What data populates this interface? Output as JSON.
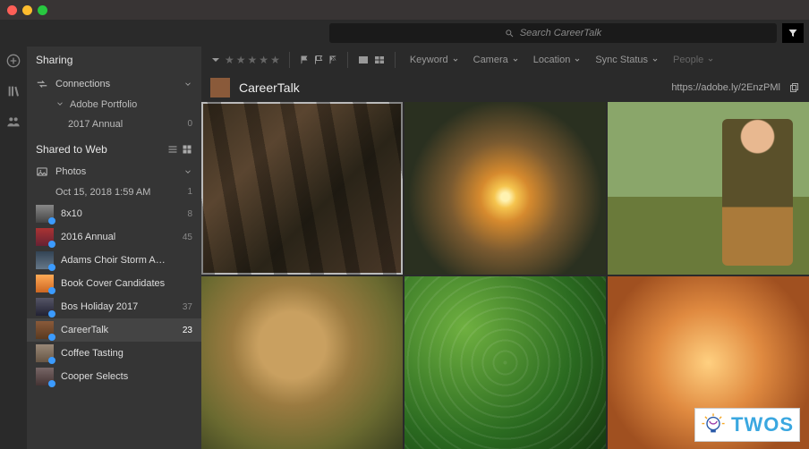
{
  "search": {
    "placeholder": "Search CareerTalk"
  },
  "sidebar": {
    "sharing_label": "Sharing",
    "connections_label": "Connections",
    "portfolio_label": "Adobe Portfolio",
    "annual_label": "2017 Annual",
    "annual_count": "0",
    "shared_to_web_label": "Shared to Web",
    "photos_label": "Photos",
    "photos_date": "Oct 15, 2018 1:59 AM",
    "photos_count": "1"
  },
  "albums": [
    {
      "name": "8x10",
      "count": "8"
    },
    {
      "name": "2016 Annual",
      "count": "45"
    },
    {
      "name": "Adams Choir Storm A…",
      "count": ""
    },
    {
      "name": "Book Cover Candidates",
      "count": ""
    },
    {
      "name": "Bos Holiday 2017",
      "count": "37"
    },
    {
      "name": "CareerTalk",
      "count": "23"
    },
    {
      "name": "Coffee Tasting",
      "count": ""
    },
    {
      "name": "Cooper Selects",
      "count": ""
    }
  ],
  "toolbar": {
    "keyword": "Keyword",
    "camera": "Camera",
    "location": "Location",
    "sync": "Sync Status",
    "people": "People"
  },
  "header": {
    "title": "CareerTalk",
    "url": "https://adobe.ly/2EnzPMl"
  },
  "watermark": {
    "text": "TWOS"
  }
}
